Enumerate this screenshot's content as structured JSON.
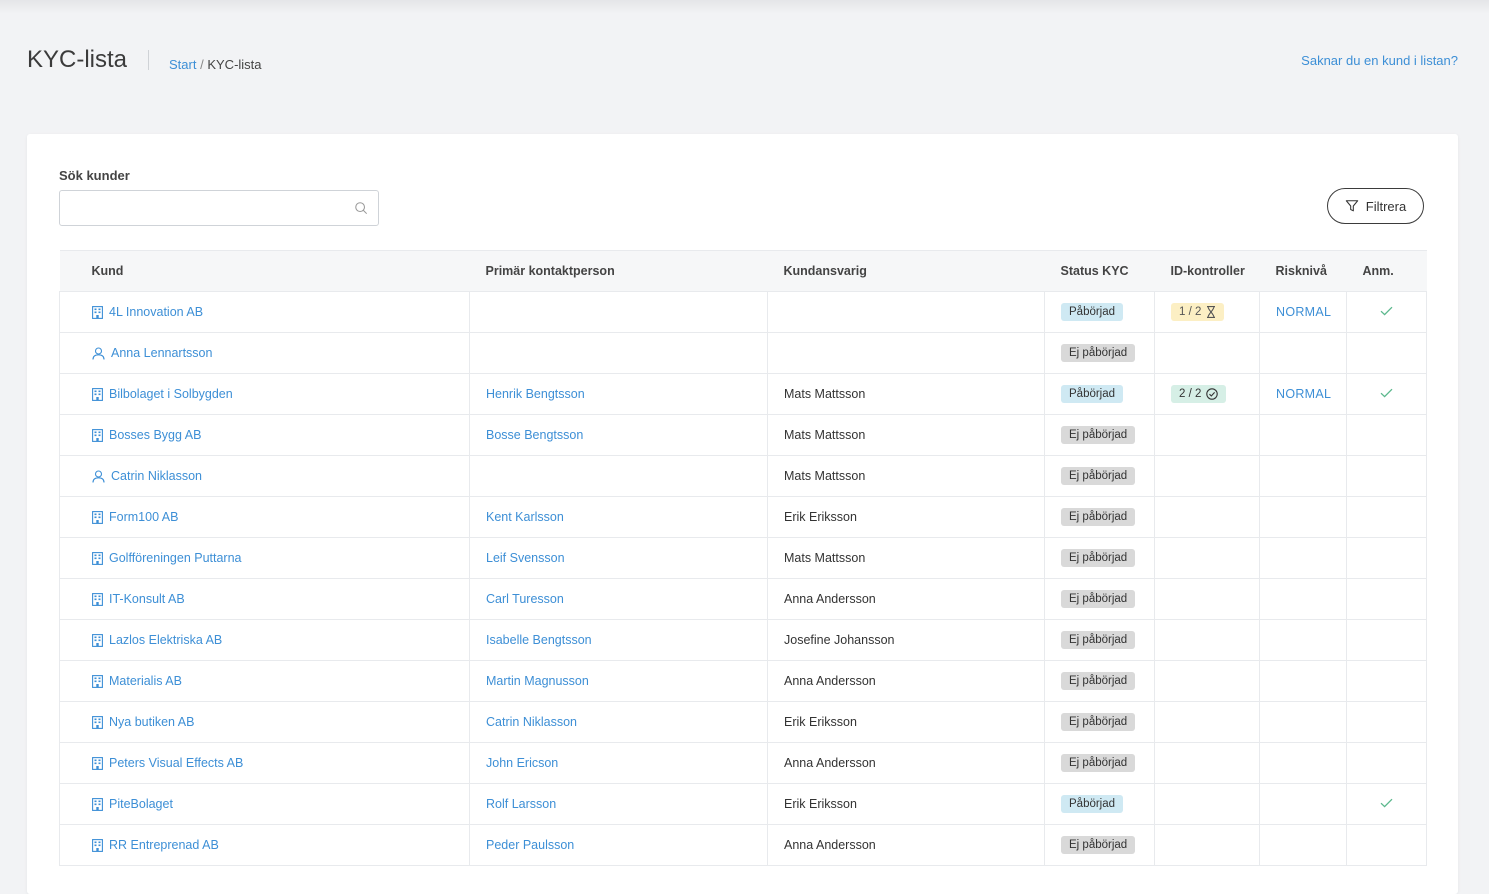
{
  "page": {
    "title": "KYC-lista",
    "breadcrumb": {
      "home": "Start",
      "separator": "/",
      "current": "KYC-lista"
    },
    "missing_customer_link": "Saknar du en kund i listan?"
  },
  "search": {
    "label": "Sök kunder",
    "value": "",
    "placeholder": ""
  },
  "filter_button": "Filtrera",
  "table": {
    "headers": [
      "Kund",
      "Primär kontaktperson",
      "Kundansvarig",
      "Status KYC",
      "ID-kontroller",
      "Risknivå",
      "Anm."
    ],
    "rows": [
      {
        "kund": "4L Innovation AB",
        "type": "company",
        "contact": "",
        "responsible": "",
        "status": "Påbörjad",
        "status_kind": "started",
        "id": "1 / 2",
        "id_state": "pending",
        "risk": "NORMAL",
        "note": true
      },
      {
        "kund": "Anna Lennartsson",
        "type": "person",
        "contact": "",
        "responsible": "",
        "status": "Ej påbörjad",
        "status_kind": "notstarted",
        "id": "",
        "id_state": "",
        "risk": "",
        "note": false
      },
      {
        "kund": "Bilbolaget i Solbygden",
        "type": "company",
        "contact": "Henrik Bengtsson",
        "responsible": "Mats Mattsson",
        "status": "Påbörjad",
        "status_kind": "started",
        "id": "2 / 2",
        "id_state": "done",
        "risk": "NORMAL",
        "note": true
      },
      {
        "kund": "Bosses Bygg AB",
        "type": "company",
        "contact": "Bosse Bengtsson",
        "responsible": "Mats Mattsson",
        "status": "Ej påbörjad",
        "status_kind": "notstarted",
        "id": "",
        "id_state": "",
        "risk": "",
        "note": false
      },
      {
        "kund": "Catrin Niklasson",
        "type": "person",
        "contact": "",
        "responsible": "Mats Mattsson",
        "status": "Ej påbörjad",
        "status_kind": "notstarted",
        "id": "",
        "id_state": "",
        "risk": "",
        "note": false
      },
      {
        "kund": "Form100 AB",
        "type": "company",
        "contact": "Kent Karlsson",
        "responsible": "Erik Eriksson",
        "status": "Ej påbörjad",
        "status_kind": "notstarted",
        "id": "",
        "id_state": "",
        "risk": "",
        "note": false
      },
      {
        "kund": "Golfföreningen Puttarna",
        "type": "company",
        "contact": "Leif Svensson",
        "responsible": "Mats Mattsson",
        "status": "Ej påbörjad",
        "status_kind": "notstarted",
        "id": "",
        "id_state": "",
        "risk": "",
        "note": false
      },
      {
        "kund": "IT-Konsult AB",
        "type": "company",
        "contact": "Carl Turesson",
        "responsible": "Anna Andersson",
        "status": "Ej påbörjad",
        "status_kind": "notstarted",
        "id": "",
        "id_state": "",
        "risk": "",
        "note": false
      },
      {
        "kund": "Lazlos Elektriska AB",
        "type": "company",
        "contact": "Isabelle Bengtsson",
        "responsible": "Josefine Johansson",
        "status": "Ej påbörjad",
        "status_kind": "notstarted",
        "id": "",
        "id_state": "",
        "risk": "",
        "note": false
      },
      {
        "kund": "Materialis AB",
        "type": "company",
        "contact": "Martin Magnusson",
        "responsible": "Anna Andersson",
        "status": "Ej påbörjad",
        "status_kind": "notstarted",
        "id": "",
        "id_state": "",
        "risk": "",
        "note": false
      },
      {
        "kund": "Nya butiken AB",
        "type": "company",
        "contact": "Catrin Niklasson",
        "responsible": "Erik Eriksson",
        "status": "Ej påbörjad",
        "status_kind": "notstarted",
        "id": "",
        "id_state": "",
        "risk": "",
        "note": false
      },
      {
        "kund": "Peters Visual Effects AB",
        "type": "company",
        "contact": "John Ericson",
        "responsible": "Anna Andersson",
        "status": "Ej påbörjad",
        "status_kind": "notstarted",
        "id": "",
        "id_state": "",
        "risk": "",
        "note": false
      },
      {
        "kund": "PiteBolaget",
        "type": "company",
        "contact": "Rolf Larsson",
        "responsible": "Erik Eriksson",
        "status": "Påbörjad",
        "status_kind": "started",
        "id": "",
        "id_state": "",
        "risk": "",
        "note": true
      },
      {
        "kund": "RR Entreprenad AB",
        "type": "company",
        "contact": "Peder Paulsson",
        "responsible": "Anna Andersson",
        "status": "Ej påbörjad",
        "status_kind": "notstarted",
        "id": "",
        "id_state": "",
        "risk": "",
        "note": false
      }
    ]
  },
  "colors": {
    "accent": "#3d8fd6",
    "check": "#5cb88d",
    "started_bg": "#cfe9f3",
    "notstarted_bg": "#d9d9d9",
    "pending_bg": "#fcefc4",
    "done_bg": "#d6efe6"
  },
  "icons": {
    "company": "building-icon",
    "person": "person-icon",
    "pending": "hourglass-icon",
    "done": "check-circle-icon",
    "note": "checkmark-icon"
  }
}
